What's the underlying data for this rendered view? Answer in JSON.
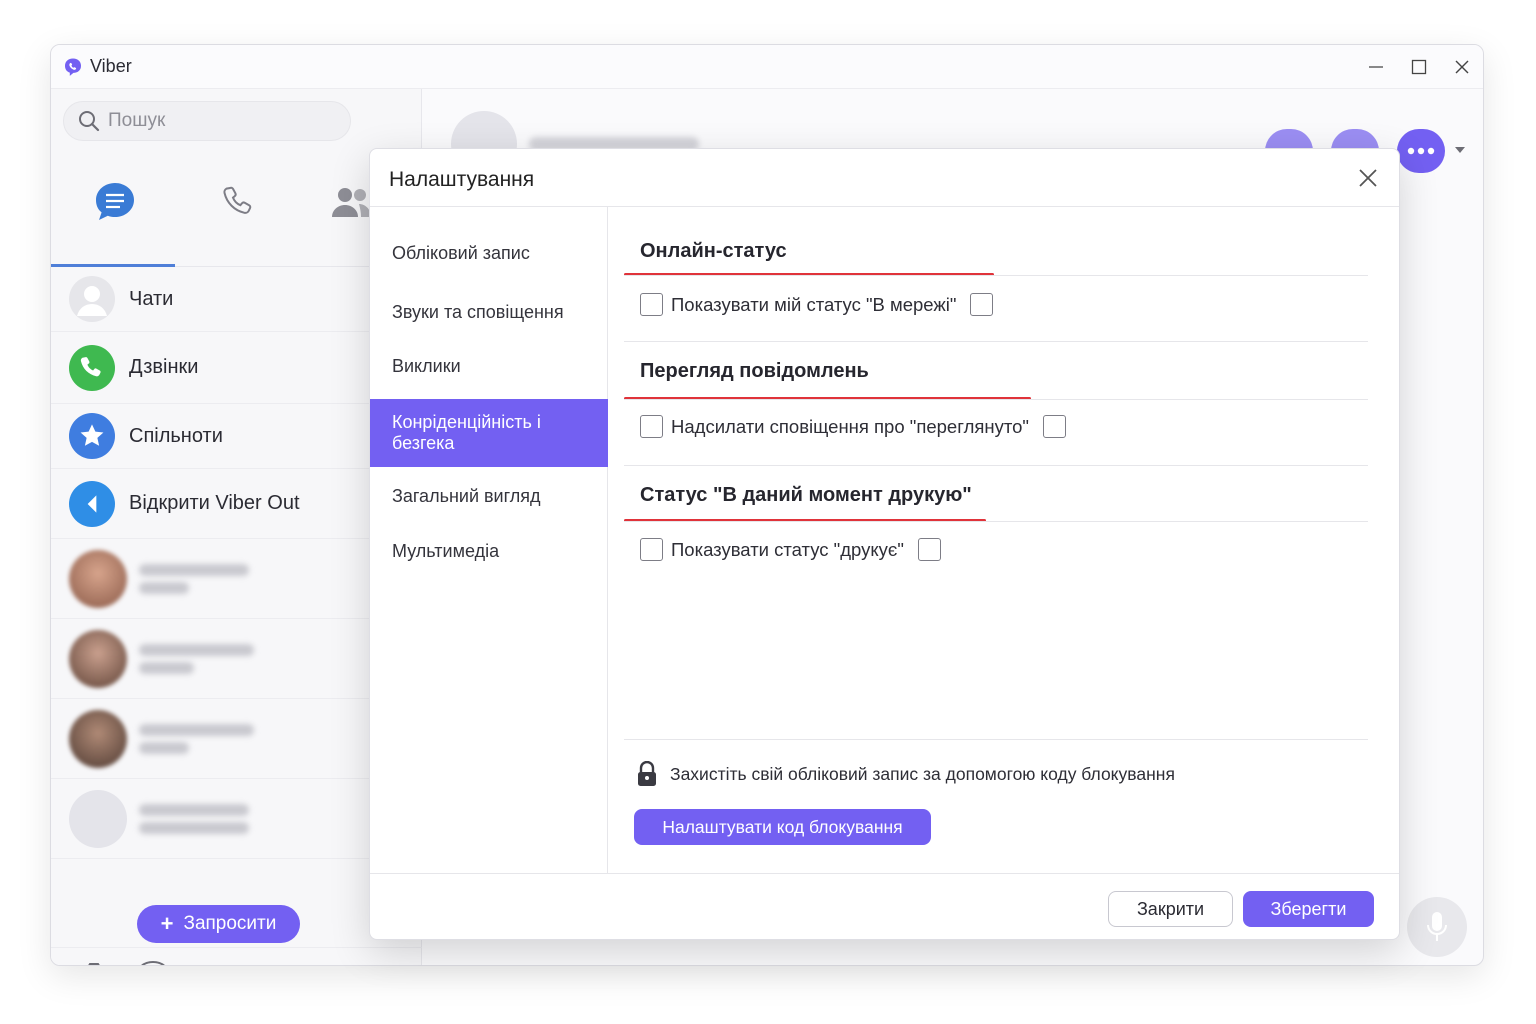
{
  "window": {
    "title": "Viber",
    "controls": [
      "minimize",
      "maximize",
      "close"
    ]
  },
  "search": {
    "placeholder": "Пошук"
  },
  "sidebar": {
    "items": [
      {
        "label": "Чати",
        "icon": "person-avatar-icon"
      },
      {
        "label": "Дзвінки",
        "icon": "phone-icon"
      },
      {
        "label": "Спільноти",
        "icon": "star-icon"
      },
      {
        "label": "Відкрити Viber Out",
        "icon": "viber-out-icon"
      }
    ],
    "invite_label": "Запросити"
  },
  "dialog": {
    "title": "Налаштування",
    "nav": [
      "Обліковий запис",
      "Звуки та сповіщення",
      "Виклики",
      "Конріденційність і безгека",
      "Загальний вигляд",
      "Мультимедіа"
    ],
    "active_nav_index": 3,
    "sections": [
      {
        "title": "Онлайн-статус",
        "option": "Показувати мій статус \"В мережі\""
      },
      {
        "title": "Перегляд повідомлень",
        "option": "Надсилати сповіщення про \"переглянуто\""
      },
      {
        "title": "Статус \"В даний момент друкую\"",
        "option": "Показувати статус \"друкує\""
      }
    ],
    "lock_text": "Захистіть свій обліковий запис за допомогою коду блокування",
    "lock_button": "Налаштувати код блокування",
    "close_button": "Закрити",
    "save_button": "Зберегти"
  },
  "colors": {
    "accent": "#7360f2",
    "section_underline": "#e0333a",
    "nav_underline": "#4f7fd8"
  }
}
